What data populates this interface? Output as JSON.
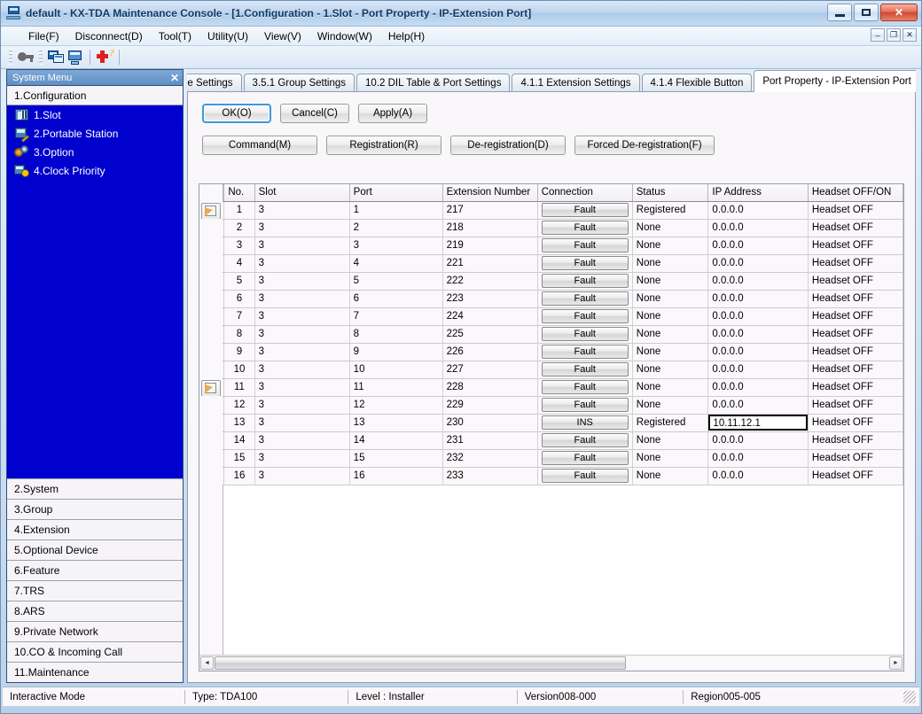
{
  "window": {
    "title": "default - KX-TDA Maintenance Console - [1.Configuration - 1.Slot - Port Property - IP-Extension Port]",
    "icon": "console-window-icon",
    "minimize_label": "–",
    "maximize_label": "□",
    "close_label": "✕"
  },
  "mdi_controls": {
    "minimize": "–",
    "restore": "❐",
    "close": "✕"
  },
  "menubar": {
    "items": [
      {
        "label": "File(F)",
        "accel": "F"
      },
      {
        "label": "Disconnect(D)",
        "accel": "D"
      },
      {
        "label": "Tool(T)",
        "accel": "T"
      },
      {
        "label": "Utility(U)",
        "accel": "U"
      },
      {
        "label": "View(V)",
        "accel": "V"
      },
      {
        "label": "Window(W)",
        "accel": "W"
      },
      {
        "label": "Help(H)",
        "accel": "H"
      }
    ]
  },
  "toolbar": {
    "buttons": [
      {
        "name": "key-icon"
      },
      {
        "name": "connect-monitor-icon"
      },
      {
        "name": "monitor-icon"
      },
      {
        "name": "help-icon"
      }
    ]
  },
  "sidebar": {
    "header": "System Menu",
    "close_label": "✕",
    "current_group": "1.Configuration",
    "tree_items": [
      {
        "label": "1.Slot",
        "icon": "slot-icon"
      },
      {
        "label": "2.Portable Station",
        "icon": "portable-station-icon"
      },
      {
        "label": "3.Option",
        "icon": "option-gear-icon"
      },
      {
        "label": "4.Clock Priority",
        "icon": "clock-priority-icon"
      }
    ],
    "items": [
      {
        "label": "2.System"
      },
      {
        "label": "3.Group"
      },
      {
        "label": "4.Extension"
      },
      {
        "label": "5.Optional Device"
      },
      {
        "label": "6.Feature"
      },
      {
        "label": "7.TRS"
      },
      {
        "label": "8.ARS"
      },
      {
        "label": "9.Private Network"
      },
      {
        "label": "10.CO & Incoming Call"
      },
      {
        "label": "11.Maintenance"
      }
    ]
  },
  "tabs": {
    "items": [
      {
        "label": "ne Settings",
        "active": false
      },
      {
        "label": "3.5.1 Group Settings",
        "active": false
      },
      {
        "label": "10.2 DIL Table & Port Settings",
        "active": false
      },
      {
        "label": "4.1.1 Extension Settings",
        "active": false
      },
      {
        "label": "4.1.4 Flexible Button",
        "active": false
      },
      {
        "label": "Port Property - IP-Extension Port",
        "active": true
      }
    ],
    "scroll_left": "◄",
    "scroll_right": "►"
  },
  "actions": {
    "primary": [
      {
        "label": "OK(O)",
        "focused": true
      },
      {
        "label": "Cancel(C)",
        "focused": false
      },
      {
        "label": "Apply(A)",
        "focused": false
      }
    ],
    "secondary": [
      {
        "label": "Command(M)",
        "wide": false
      },
      {
        "label": "Registration(R)",
        "wide": false
      },
      {
        "label": "De-registration(D)",
        "wide": false
      },
      {
        "label": "Forced De-registration(F)",
        "wide": true
      }
    ]
  },
  "grid": {
    "corner_label": "-",
    "columns": [
      "No.",
      "Slot",
      "Port",
      "Extension Number",
      "Connection",
      "Status",
      "IP Address",
      "Headset OFF/ON"
    ],
    "rows": [
      {
        "marker": true,
        "no": "1",
        "slot": "3",
        "port": "1",
        "ext": "217",
        "connection": "Fault",
        "status": "Registered",
        "ip": "0.0.0.0",
        "headset": "Headset OFF",
        "ip_selected": false
      },
      {
        "marker": false,
        "no": "2",
        "slot": "3",
        "port": "2",
        "ext": "218",
        "connection": "Fault",
        "status": "None",
        "ip": "0.0.0.0",
        "headset": "Headset OFF",
        "ip_selected": false
      },
      {
        "marker": false,
        "no": "3",
        "slot": "3",
        "port": "3",
        "ext": "219",
        "connection": "Fault",
        "status": "None",
        "ip": "0.0.0.0",
        "headset": "Headset OFF",
        "ip_selected": false
      },
      {
        "marker": false,
        "no": "4",
        "slot": "3",
        "port": "4",
        "ext": "221",
        "connection": "Fault",
        "status": "None",
        "ip": "0.0.0.0",
        "headset": "Headset OFF",
        "ip_selected": false
      },
      {
        "marker": false,
        "no": "5",
        "slot": "3",
        "port": "5",
        "ext": "222",
        "connection": "Fault",
        "status": "None",
        "ip": "0.0.0.0",
        "headset": "Headset OFF",
        "ip_selected": false
      },
      {
        "marker": false,
        "no": "6",
        "slot": "3",
        "port": "6",
        "ext": "223",
        "connection": "Fault",
        "status": "None",
        "ip": "0.0.0.0",
        "headset": "Headset OFF",
        "ip_selected": false
      },
      {
        "marker": false,
        "no": "7",
        "slot": "3",
        "port": "7",
        "ext": "224",
        "connection": "Fault",
        "status": "None",
        "ip": "0.0.0.0",
        "headset": "Headset OFF",
        "ip_selected": false
      },
      {
        "marker": false,
        "no": "8",
        "slot": "3",
        "port": "8",
        "ext": "225",
        "connection": "Fault",
        "status": "None",
        "ip": "0.0.0.0",
        "headset": "Headset OFF",
        "ip_selected": false
      },
      {
        "marker": false,
        "no": "9",
        "slot": "3",
        "port": "9",
        "ext": "226",
        "connection": "Fault",
        "status": "None",
        "ip": "0.0.0.0",
        "headset": "Headset OFF",
        "ip_selected": false
      },
      {
        "marker": false,
        "no": "10",
        "slot": "3",
        "port": "10",
        "ext": "227",
        "connection": "Fault",
        "status": "None",
        "ip": "0.0.0.0",
        "headset": "Headset OFF",
        "ip_selected": false
      },
      {
        "marker": true,
        "no": "11",
        "slot": "3",
        "port": "11",
        "ext": "228",
        "connection": "Fault",
        "status": "None",
        "ip": "0.0.0.0",
        "headset": "Headset OFF",
        "ip_selected": false
      },
      {
        "marker": false,
        "no": "12",
        "slot": "3",
        "port": "12",
        "ext": "229",
        "connection": "Fault",
        "status": "None",
        "ip": "0.0.0.0",
        "headset": "Headset OFF",
        "ip_selected": false
      },
      {
        "marker": false,
        "no": "13",
        "slot": "3",
        "port": "13",
        "ext": "230",
        "connection": "INS",
        "status": "Registered",
        "ip": "10.11.12.1",
        "headset": "Headset OFF",
        "ip_selected": true
      },
      {
        "marker": false,
        "no": "14",
        "slot": "3",
        "port": "14",
        "ext": "231",
        "connection": "Fault",
        "status": "None",
        "ip": "0.0.0.0",
        "headset": "Headset OFF",
        "ip_selected": false
      },
      {
        "marker": false,
        "no": "15",
        "slot": "3",
        "port": "15",
        "ext": "232",
        "connection": "Fault",
        "status": "None",
        "ip": "0.0.0.0",
        "headset": "Headset OFF",
        "ip_selected": false
      },
      {
        "marker": false,
        "no": "16",
        "slot": "3",
        "port": "16",
        "ext": "233",
        "connection": "Fault",
        "status": "None",
        "ip": "0.0.0.0",
        "headset": "Headset OFF",
        "ip_selected": false
      }
    ],
    "scrollbar": {
      "left_arrow": "◄",
      "right_arrow": "►"
    }
  },
  "statusbar": {
    "mode": "Interactive Mode",
    "type": "Type: TDA100",
    "level": "Level : Installer",
    "version": "Version008-000",
    "region": "Region005-005"
  },
  "colors": {
    "tree_selection": "#0000cf",
    "titlebar_text": "#123a63",
    "focus_border": "#3c9ad8",
    "close_button": "#d0482f"
  }
}
